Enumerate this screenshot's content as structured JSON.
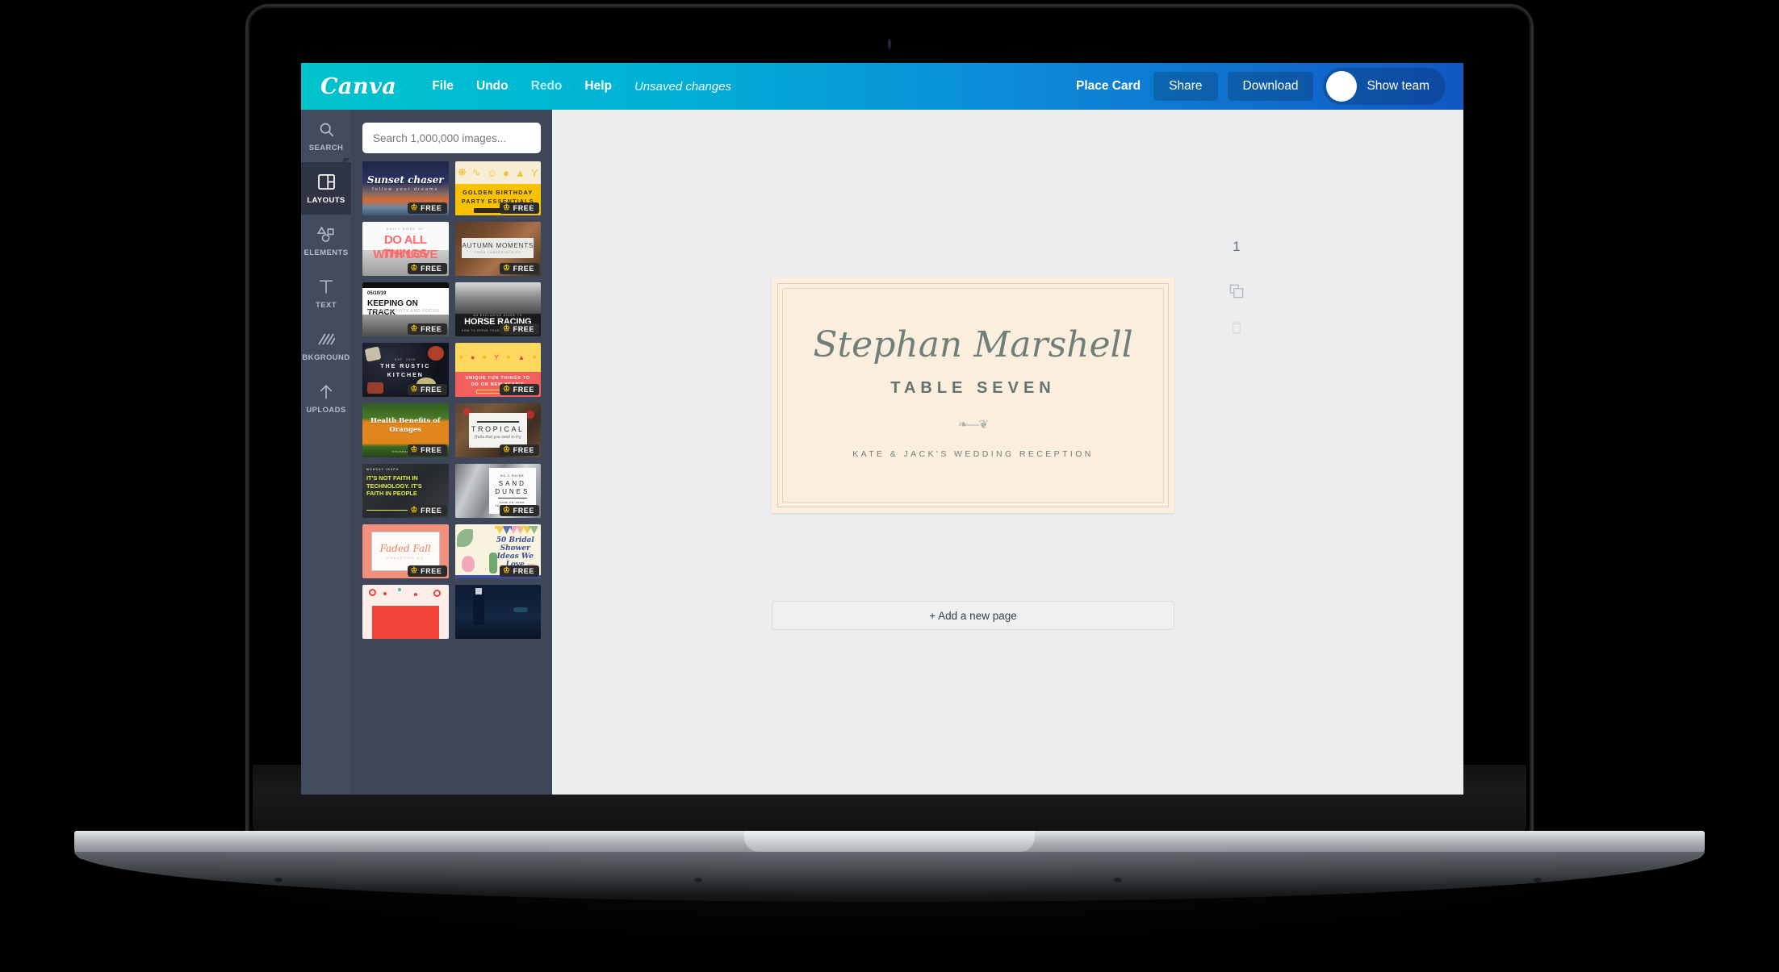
{
  "app": {
    "brand": "Canva",
    "menu": [
      {
        "label": "File",
        "dim": false
      },
      {
        "label": "Undo",
        "dim": false
      },
      {
        "label": "Redo",
        "dim": true
      },
      {
        "label": "Help",
        "dim": false
      }
    ],
    "status": "Unsaved changes",
    "document_title": "Place Card",
    "share_label": "Share",
    "download_label": "Download",
    "team_label": "Show team",
    "accent_start": "#00c4cc",
    "accent_end": "#1257c2"
  },
  "rail": {
    "items": [
      {
        "label": "SEARCH",
        "icon": "search-icon",
        "active": false
      },
      {
        "label": "LAYOUTS",
        "icon": "layouts-icon",
        "active": true
      },
      {
        "label": "ELEMENTS",
        "icon": "elements-icon",
        "active": false
      },
      {
        "label": "TEXT",
        "icon": "text-icon",
        "active": false
      },
      {
        "label": "BKGROUND",
        "icon": "background-icon",
        "active": false
      },
      {
        "label": "UPLOADS",
        "icon": "upload-icon",
        "active": false
      }
    ]
  },
  "panel": {
    "search": {
      "placeholder": "Search 1,000,000 images...",
      "value": ""
    },
    "badge_label": "FREE",
    "templates": [
      {
        "id": "sunset-chaser",
        "title": "Sunset chaser",
        "subtitle": "follow your dreams",
        "free": true
      },
      {
        "id": "golden-birthday",
        "title": "GOLDEN BIRTHDAY",
        "subtitle": "PARTY ESSENTIALS",
        "free": true
      },
      {
        "id": "do-all-things",
        "title": "DO ALL THINGS",
        "subtitle": "WITH LOVE",
        "free": true
      },
      {
        "id": "autumn-moments",
        "title": "AUTUMN MOMENTS",
        "subtitle": "FROM LUMBERJACKIES",
        "free": true
      },
      {
        "id": "keeping-on-track",
        "title": "KEEPING ON TRACK",
        "subtitle": "// PRODUCTIVITY AND FOCUS",
        "date": "05/10/19",
        "free": true
      },
      {
        "id": "horse-racing",
        "title": "HORSE RACING",
        "subtitle": "AN EXCLUSIVE GUIDE TO",
        "free": true
      },
      {
        "id": "rustic-kitchen",
        "title": "THE RUSTIC KITCHEN",
        "subtitle": "EST. 2008",
        "free": true
      },
      {
        "id": "new-years",
        "title": "UNIQUE FUN THINGS TO",
        "subtitle": "DO ON NEW YEAR'S",
        "free": true
      },
      {
        "id": "health-oranges",
        "title": "Health Benefits of Oranges",
        "subtitle": "freshmart.com",
        "free": true
      },
      {
        "id": "tropical",
        "title": "TROPICAL",
        "subtitle": "fruits that you need to try",
        "free": true
      },
      {
        "id": "faith-in-people",
        "title": "IT'S NOT FAITH IN TECHNOLOGY. IT'S FAITH IN PEOPLE",
        "subtitle": "MONDAY INSPO",
        "free": true
      },
      {
        "id": "sand-dunes",
        "title": "SAND DUNES",
        "subtitle": "NO.3 GUIDE",
        "free": true
      },
      {
        "id": "faded-fall",
        "title": "Faded Fall",
        "subtitle": "GRACETIPS.CO",
        "free": true
      },
      {
        "id": "bridal-shower",
        "title": "50 Bridal Shower Ideas We Love",
        "subtitle": "",
        "free": true
      },
      {
        "id": "confetti-red",
        "title": "",
        "subtitle": "",
        "free": false
      },
      {
        "id": "city-night",
        "title": "",
        "subtitle": "",
        "free": false
      }
    ]
  },
  "canvas": {
    "page_number": "1",
    "add_page_label": "+ Add a new page",
    "design": {
      "name": "Stephan Marshell",
      "table": "TABLE SEVEN",
      "flourish": "❧―❦",
      "subtitle": "KATE & JACK'S WEDDING RECEPTION",
      "bg_color": "#fceedd",
      "text_color": "#6f7f7c"
    },
    "tools": [
      {
        "name": "duplicate-page-icon"
      },
      {
        "name": "delete-page-icon"
      }
    ]
  }
}
